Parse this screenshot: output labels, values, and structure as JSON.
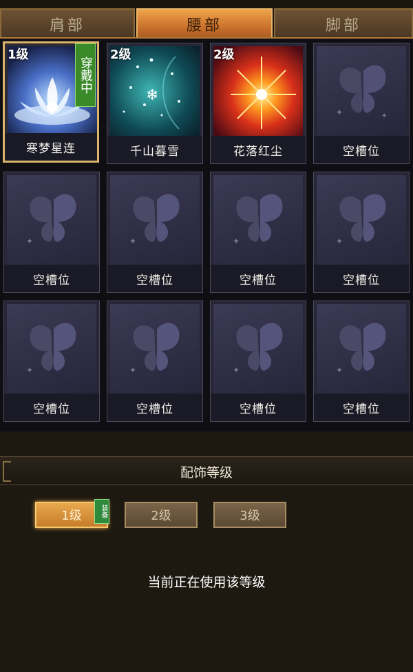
{
  "tabs": [
    {
      "label": "肩部"
    },
    {
      "label": "腰部",
      "active": true
    },
    {
      "label": "脚部"
    }
  ],
  "slots": [
    {
      "name": "寒梦星连",
      "level": "1级",
      "wear_label": "穿戴中",
      "icon": "lotus-icon"
    },
    {
      "name": "千山暮雪",
      "level": "2级",
      "icon": "snow-icon"
    },
    {
      "name": "花落红尘",
      "level": "2级",
      "icon": "flame-burst-icon"
    },
    {
      "name": "空槽位"
    },
    {
      "name": "空槽位"
    },
    {
      "name": "空槽位"
    },
    {
      "name": "空槽位"
    },
    {
      "name": "空槽位"
    },
    {
      "name": "空槽位"
    },
    {
      "name": "空槽位"
    },
    {
      "name": "空槽位"
    },
    {
      "name": "空槽位"
    }
  ],
  "level_section": {
    "title": "配饰等级",
    "buttons": [
      {
        "label": "1级",
        "active": true
      },
      {
        "label": "2级"
      },
      {
        "label": "3级"
      }
    ],
    "equip_badge": "装备",
    "status_text": "当前正在使用该等级"
  },
  "colors": {
    "accent": "#e8a84e",
    "wear_badge": "#3a8a2a",
    "slot_bg": "#262636"
  }
}
